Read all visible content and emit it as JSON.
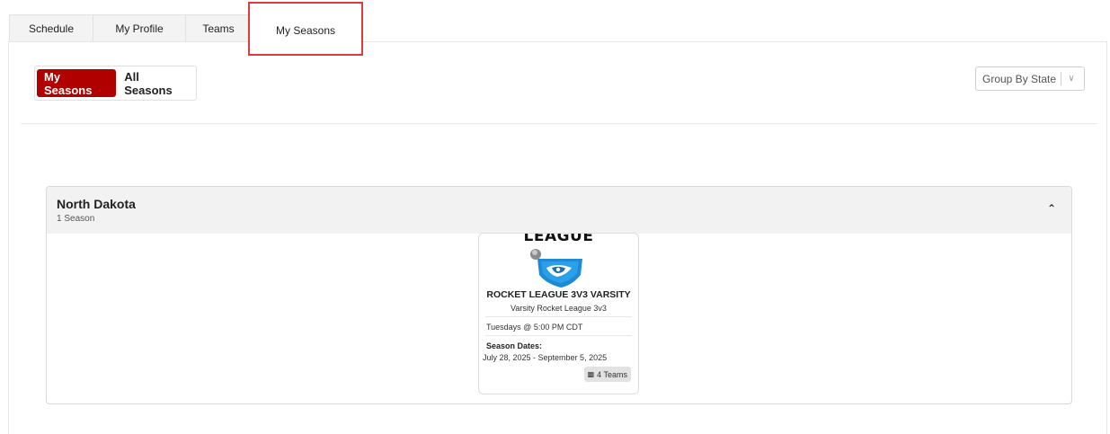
{
  "tabs": [
    {
      "label": "Schedule"
    },
    {
      "label": "My Profile"
    },
    {
      "label": "Teams"
    },
    {
      "label": "My Seasons",
      "active": true
    }
  ],
  "toggle": {
    "selected": "My Seasons",
    "other": "All Seasons"
  },
  "group_by": {
    "label": "Group By State"
  },
  "state_group": {
    "name": "North Dakota",
    "count": "1 Season",
    "season": {
      "logo_text": "LEAGUE",
      "title": "ROCKET LEAGUE 3V3 VARSITY",
      "subtitle": "Varsity Rocket League 3v3",
      "time": "Tuesdays @ 5:00 PM CDT",
      "dates_label": "Season Dates:",
      "dates": "July 28, 2025 - September 5, 2025",
      "teams": "4 Teams"
    }
  },
  "colors": {
    "accent": "#b10000",
    "highlight": "#e0393e",
    "logo_blue": "#1d8ad6"
  },
  "icons": [
    "chevron-down-icon",
    "chevron-up-icon",
    "teams-icon",
    "rocket-league-logo"
  ]
}
